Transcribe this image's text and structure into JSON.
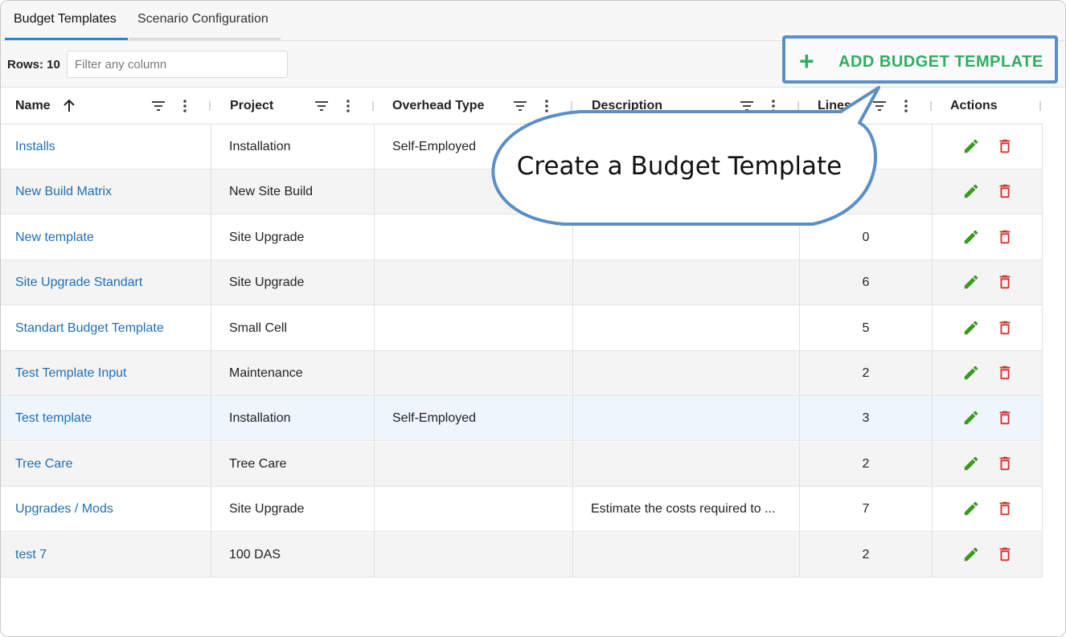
{
  "tabs": [
    {
      "label": "Budget Templates",
      "active": true
    },
    {
      "label": "Scenario Configuration",
      "active": false
    }
  ],
  "toolbar": {
    "rows_label": "Rows:",
    "rows_count": "10",
    "filter_placeholder": "Filter any column",
    "add_button_label": "ADD BUDGET TEMPLATE"
  },
  "table": {
    "columns": [
      "Name",
      "Project",
      "Overhead Type",
      "Description",
      "Lines",
      "Actions"
    ],
    "sort_column": "Name",
    "rows": [
      {
        "name": "Installs",
        "project": "Installation",
        "overhead": "Self-Employed",
        "description": "",
        "lines": ""
      },
      {
        "name": "New Build Matrix",
        "project": "New Site Build",
        "overhead": "",
        "description": "",
        "lines": ""
      },
      {
        "name": "New template",
        "project": "Site Upgrade",
        "overhead": "",
        "description": "",
        "lines": "0"
      },
      {
        "name": "Site Upgrade Standart",
        "project": "Site Upgrade",
        "overhead": "",
        "description": "",
        "lines": "6"
      },
      {
        "name": "Standart Budget Template",
        "project": "Small Cell",
        "overhead": "",
        "description": "",
        "lines": "5"
      },
      {
        "name": "Test Template Input",
        "project": "Maintenance",
        "overhead": "",
        "description": "",
        "lines": "2"
      },
      {
        "name": "Test template",
        "project": "Installation",
        "overhead": "Self-Employed",
        "description": "",
        "lines": "3"
      },
      {
        "name": "Tree Care",
        "project": "Tree Care",
        "overhead": "",
        "description": "",
        "lines": "2"
      },
      {
        "name": "Upgrades / Mods",
        "project": "Site Upgrade",
        "overhead": "",
        "description": "Estimate the costs required to ...",
        "lines": "7"
      },
      {
        "name": "test 7",
        "project": "100 DAS",
        "overhead": "",
        "description": "",
        "lines": "2"
      }
    ]
  },
  "callout": {
    "text": "Create a Budget Template"
  },
  "colors": {
    "accent": "#1e88e5",
    "link": "#1f6fb2",
    "add_green": "#2fae62",
    "edit_green": "#3a9a1e",
    "delete_red": "#d32f2f",
    "callout_border": "#5b8fc7"
  },
  "icons": [
    "sort-ascending-icon",
    "filter-icon",
    "more-vertical-icon",
    "plus-icon",
    "edit-pencil-icon",
    "delete-trash-icon"
  ]
}
